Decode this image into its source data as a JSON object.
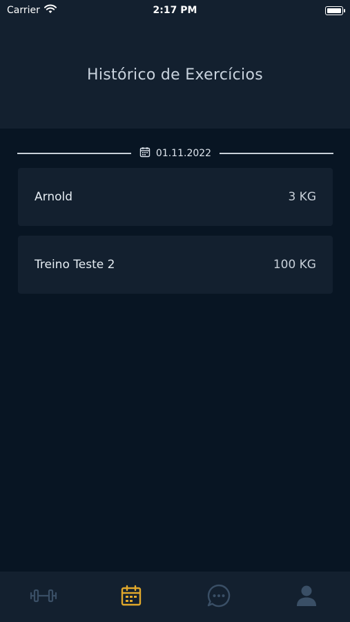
{
  "status_bar": {
    "carrier": "Carrier",
    "time": "2:17 PM"
  },
  "header": {
    "title": "Histórico de Exercícios"
  },
  "history": {
    "date": "01.11.2022",
    "entries": [
      {
        "name": "Arnold",
        "weight": "3 KG"
      },
      {
        "name": "Treino Teste 2",
        "weight": "100 KG"
      }
    ]
  },
  "tab_bar": {
    "tabs": [
      {
        "icon": "dumbbell-icon",
        "active": false
      },
      {
        "icon": "calendar-icon",
        "active": true
      },
      {
        "icon": "chat-icon",
        "active": false
      },
      {
        "icon": "user-icon",
        "active": false
      }
    ],
    "active_color": "#e2a92b",
    "inactive_color": "#3a4f66"
  },
  "colors": {
    "background": "#081523",
    "surface": "#13202f"
  }
}
